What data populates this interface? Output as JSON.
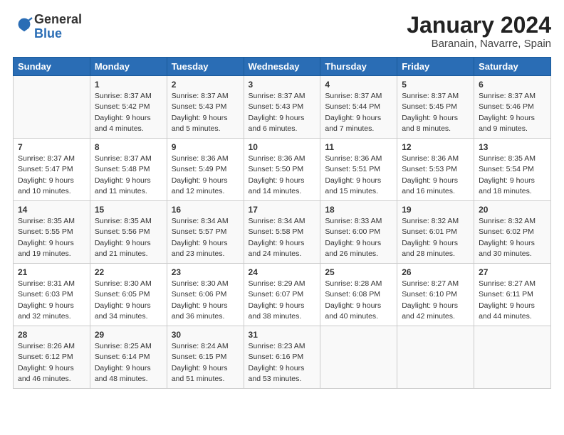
{
  "logo": {
    "general": "General",
    "blue": "Blue"
  },
  "header": {
    "title": "January 2024",
    "subtitle": "Baranain, Navarre, Spain"
  },
  "days_of_week": [
    "Sunday",
    "Monday",
    "Tuesday",
    "Wednesday",
    "Thursday",
    "Friday",
    "Saturday"
  ],
  "weeks": [
    [
      {
        "day": "",
        "sunrise": "",
        "sunset": "",
        "daylight": ""
      },
      {
        "day": "1",
        "sunrise": "Sunrise: 8:37 AM",
        "sunset": "Sunset: 5:42 PM",
        "daylight": "Daylight: 9 hours and 4 minutes."
      },
      {
        "day": "2",
        "sunrise": "Sunrise: 8:37 AM",
        "sunset": "Sunset: 5:43 PM",
        "daylight": "Daylight: 9 hours and 5 minutes."
      },
      {
        "day": "3",
        "sunrise": "Sunrise: 8:37 AM",
        "sunset": "Sunset: 5:43 PM",
        "daylight": "Daylight: 9 hours and 6 minutes."
      },
      {
        "day": "4",
        "sunrise": "Sunrise: 8:37 AM",
        "sunset": "Sunset: 5:44 PM",
        "daylight": "Daylight: 9 hours and 7 minutes."
      },
      {
        "day": "5",
        "sunrise": "Sunrise: 8:37 AM",
        "sunset": "Sunset: 5:45 PM",
        "daylight": "Daylight: 9 hours and 8 minutes."
      },
      {
        "day": "6",
        "sunrise": "Sunrise: 8:37 AM",
        "sunset": "Sunset: 5:46 PM",
        "daylight": "Daylight: 9 hours and 9 minutes."
      }
    ],
    [
      {
        "day": "7",
        "sunrise": "Sunrise: 8:37 AM",
        "sunset": "Sunset: 5:47 PM",
        "daylight": "Daylight: 9 hours and 10 minutes."
      },
      {
        "day": "8",
        "sunrise": "Sunrise: 8:37 AM",
        "sunset": "Sunset: 5:48 PM",
        "daylight": "Daylight: 9 hours and 11 minutes."
      },
      {
        "day": "9",
        "sunrise": "Sunrise: 8:36 AM",
        "sunset": "Sunset: 5:49 PM",
        "daylight": "Daylight: 9 hours and 12 minutes."
      },
      {
        "day": "10",
        "sunrise": "Sunrise: 8:36 AM",
        "sunset": "Sunset: 5:50 PM",
        "daylight": "Daylight: 9 hours and 14 minutes."
      },
      {
        "day": "11",
        "sunrise": "Sunrise: 8:36 AM",
        "sunset": "Sunset: 5:51 PM",
        "daylight": "Daylight: 9 hours and 15 minutes."
      },
      {
        "day": "12",
        "sunrise": "Sunrise: 8:36 AM",
        "sunset": "Sunset: 5:53 PM",
        "daylight": "Daylight: 9 hours and 16 minutes."
      },
      {
        "day": "13",
        "sunrise": "Sunrise: 8:35 AM",
        "sunset": "Sunset: 5:54 PM",
        "daylight": "Daylight: 9 hours and 18 minutes."
      }
    ],
    [
      {
        "day": "14",
        "sunrise": "Sunrise: 8:35 AM",
        "sunset": "Sunset: 5:55 PM",
        "daylight": "Daylight: 9 hours and 19 minutes."
      },
      {
        "day": "15",
        "sunrise": "Sunrise: 8:35 AM",
        "sunset": "Sunset: 5:56 PM",
        "daylight": "Daylight: 9 hours and 21 minutes."
      },
      {
        "day": "16",
        "sunrise": "Sunrise: 8:34 AM",
        "sunset": "Sunset: 5:57 PM",
        "daylight": "Daylight: 9 hours and 23 minutes."
      },
      {
        "day": "17",
        "sunrise": "Sunrise: 8:34 AM",
        "sunset": "Sunset: 5:58 PM",
        "daylight": "Daylight: 9 hours and 24 minutes."
      },
      {
        "day": "18",
        "sunrise": "Sunrise: 8:33 AM",
        "sunset": "Sunset: 6:00 PM",
        "daylight": "Daylight: 9 hours and 26 minutes."
      },
      {
        "day": "19",
        "sunrise": "Sunrise: 8:32 AM",
        "sunset": "Sunset: 6:01 PM",
        "daylight": "Daylight: 9 hours and 28 minutes."
      },
      {
        "day": "20",
        "sunrise": "Sunrise: 8:32 AM",
        "sunset": "Sunset: 6:02 PM",
        "daylight": "Daylight: 9 hours and 30 minutes."
      }
    ],
    [
      {
        "day": "21",
        "sunrise": "Sunrise: 8:31 AM",
        "sunset": "Sunset: 6:03 PM",
        "daylight": "Daylight: 9 hours and 32 minutes."
      },
      {
        "day": "22",
        "sunrise": "Sunrise: 8:30 AM",
        "sunset": "Sunset: 6:05 PM",
        "daylight": "Daylight: 9 hours and 34 minutes."
      },
      {
        "day": "23",
        "sunrise": "Sunrise: 8:30 AM",
        "sunset": "Sunset: 6:06 PM",
        "daylight": "Daylight: 9 hours and 36 minutes."
      },
      {
        "day": "24",
        "sunrise": "Sunrise: 8:29 AM",
        "sunset": "Sunset: 6:07 PM",
        "daylight": "Daylight: 9 hours and 38 minutes."
      },
      {
        "day": "25",
        "sunrise": "Sunrise: 8:28 AM",
        "sunset": "Sunset: 6:08 PM",
        "daylight": "Daylight: 9 hours and 40 minutes."
      },
      {
        "day": "26",
        "sunrise": "Sunrise: 8:27 AM",
        "sunset": "Sunset: 6:10 PM",
        "daylight": "Daylight: 9 hours and 42 minutes."
      },
      {
        "day": "27",
        "sunrise": "Sunrise: 8:27 AM",
        "sunset": "Sunset: 6:11 PM",
        "daylight": "Daylight: 9 hours and 44 minutes."
      }
    ],
    [
      {
        "day": "28",
        "sunrise": "Sunrise: 8:26 AM",
        "sunset": "Sunset: 6:12 PM",
        "daylight": "Daylight: 9 hours and 46 minutes."
      },
      {
        "day": "29",
        "sunrise": "Sunrise: 8:25 AM",
        "sunset": "Sunset: 6:14 PM",
        "daylight": "Daylight: 9 hours and 48 minutes."
      },
      {
        "day": "30",
        "sunrise": "Sunrise: 8:24 AM",
        "sunset": "Sunset: 6:15 PM",
        "daylight": "Daylight: 9 hours and 51 minutes."
      },
      {
        "day": "31",
        "sunrise": "Sunrise: 8:23 AM",
        "sunset": "Sunset: 6:16 PM",
        "daylight": "Daylight: 9 hours and 53 minutes."
      },
      {
        "day": "",
        "sunrise": "",
        "sunset": "",
        "daylight": ""
      },
      {
        "day": "",
        "sunrise": "",
        "sunset": "",
        "daylight": ""
      },
      {
        "day": "",
        "sunrise": "",
        "sunset": "",
        "daylight": ""
      }
    ]
  ]
}
